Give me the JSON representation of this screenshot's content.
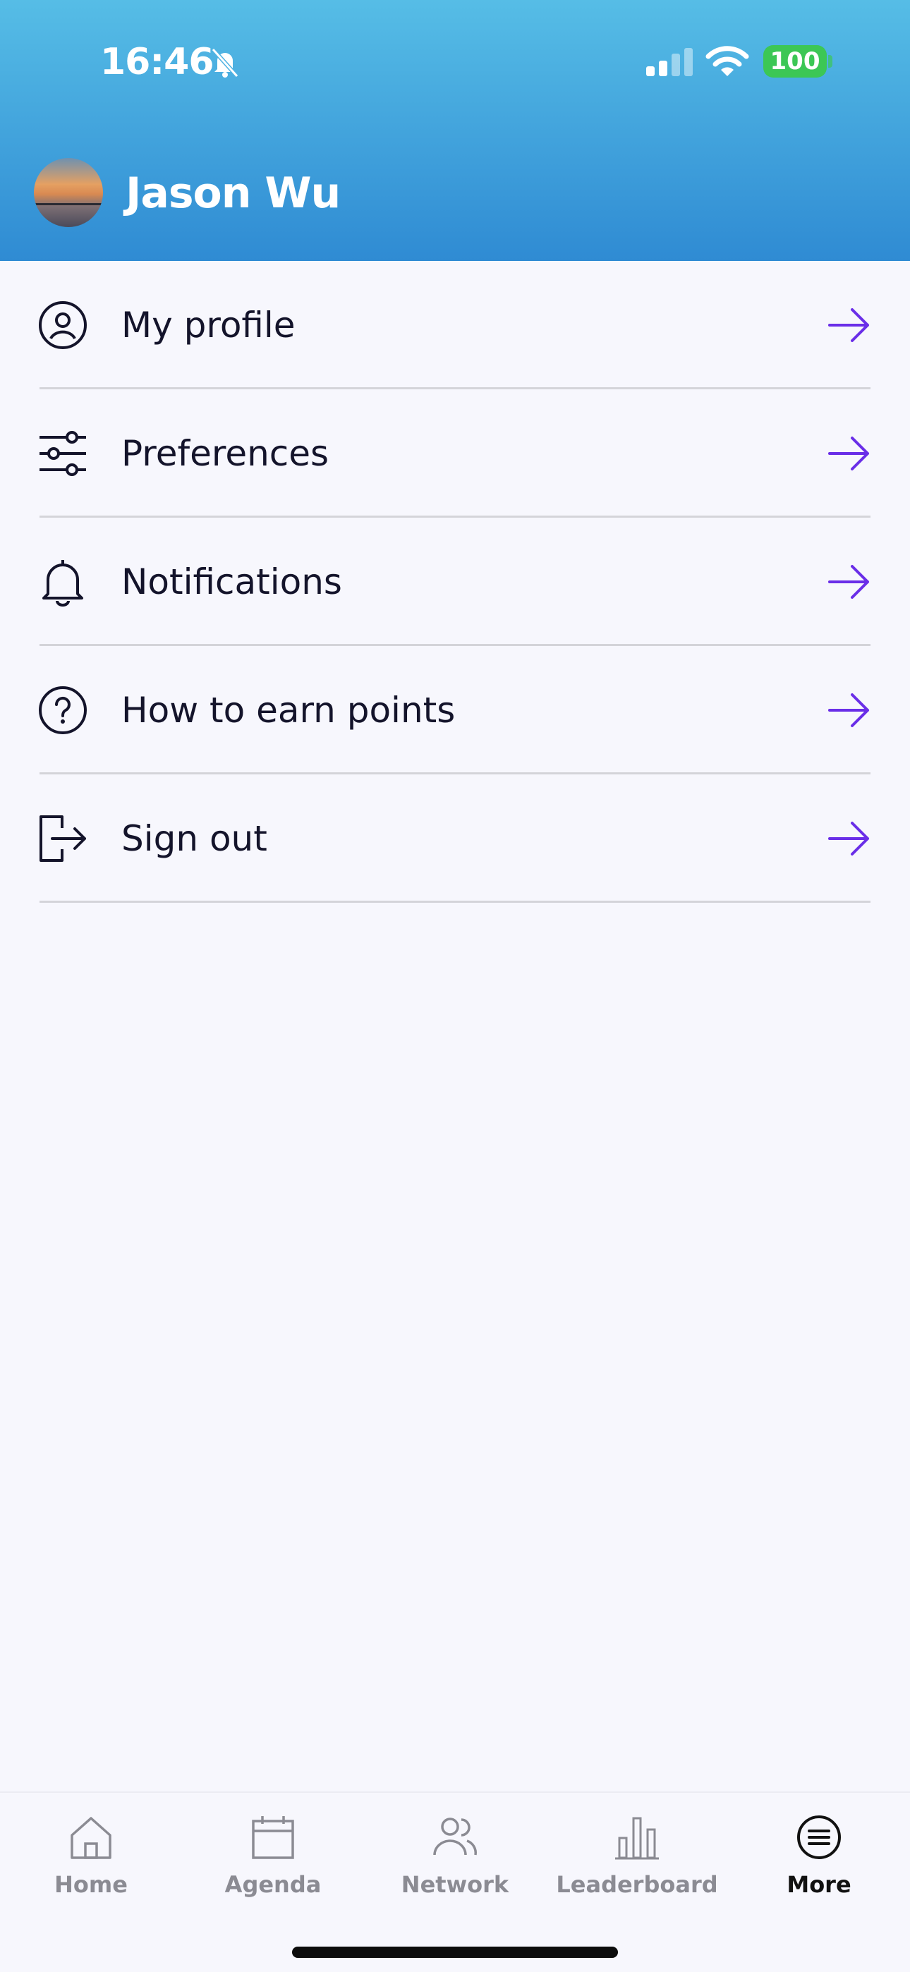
{
  "status_bar": {
    "time": "16:46",
    "battery": "100",
    "icons": [
      "bell-off-icon",
      "cellular-signal-icon",
      "wifi-icon",
      "battery-icon"
    ]
  },
  "header": {
    "user_name": "Jason Wu",
    "gradient_colors": [
      "#56bde6",
      "#2f8bd3"
    ]
  },
  "menu": {
    "items": [
      {
        "label": "My profile",
        "icon": "user-circle-icon"
      },
      {
        "label": "Preferences",
        "icon": "sliders-icon"
      },
      {
        "label": "Notifications",
        "icon": "bell-icon"
      },
      {
        "label": "How to earn points",
        "icon": "question-circle-icon"
      },
      {
        "label": "Sign out",
        "icon": "sign-out-icon"
      }
    ],
    "arrow_color": "#6a2ee8"
  },
  "tabbar": {
    "tabs": [
      {
        "label": "Home",
        "icon": "home-icon",
        "active": false
      },
      {
        "label": "Agenda",
        "icon": "calendar-icon",
        "active": false
      },
      {
        "label": "Network",
        "icon": "users-icon",
        "active": false
      },
      {
        "label": "Leaderboard",
        "icon": "bar-chart-icon",
        "active": false
      },
      {
        "label": "More",
        "icon": "menu-circle-icon",
        "active": true
      }
    ]
  }
}
